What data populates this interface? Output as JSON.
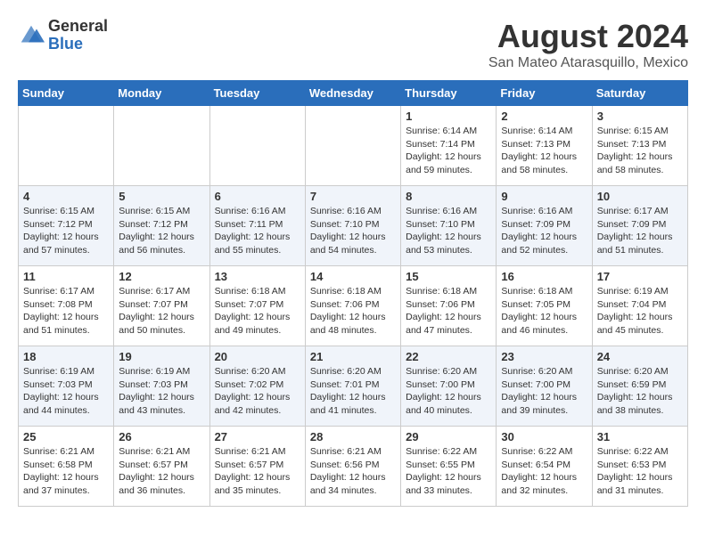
{
  "header": {
    "logo_general": "General",
    "logo_blue": "Blue",
    "month_title": "August 2024",
    "location": "San Mateo Atarasquillo, Mexico"
  },
  "weekdays": [
    "Sunday",
    "Monday",
    "Tuesday",
    "Wednesday",
    "Thursday",
    "Friday",
    "Saturday"
  ],
  "weeks": [
    [
      {
        "day": "",
        "info": ""
      },
      {
        "day": "",
        "info": ""
      },
      {
        "day": "",
        "info": ""
      },
      {
        "day": "",
        "info": ""
      },
      {
        "day": "1",
        "info": "Sunrise: 6:14 AM\nSunset: 7:14 PM\nDaylight: 12 hours\nand 59 minutes."
      },
      {
        "day": "2",
        "info": "Sunrise: 6:14 AM\nSunset: 7:13 PM\nDaylight: 12 hours\nand 58 minutes."
      },
      {
        "day": "3",
        "info": "Sunrise: 6:15 AM\nSunset: 7:13 PM\nDaylight: 12 hours\nand 58 minutes."
      }
    ],
    [
      {
        "day": "4",
        "info": "Sunrise: 6:15 AM\nSunset: 7:12 PM\nDaylight: 12 hours\nand 57 minutes."
      },
      {
        "day": "5",
        "info": "Sunrise: 6:15 AM\nSunset: 7:12 PM\nDaylight: 12 hours\nand 56 minutes."
      },
      {
        "day": "6",
        "info": "Sunrise: 6:16 AM\nSunset: 7:11 PM\nDaylight: 12 hours\nand 55 minutes."
      },
      {
        "day": "7",
        "info": "Sunrise: 6:16 AM\nSunset: 7:10 PM\nDaylight: 12 hours\nand 54 minutes."
      },
      {
        "day": "8",
        "info": "Sunrise: 6:16 AM\nSunset: 7:10 PM\nDaylight: 12 hours\nand 53 minutes."
      },
      {
        "day": "9",
        "info": "Sunrise: 6:16 AM\nSunset: 7:09 PM\nDaylight: 12 hours\nand 52 minutes."
      },
      {
        "day": "10",
        "info": "Sunrise: 6:17 AM\nSunset: 7:09 PM\nDaylight: 12 hours\nand 51 minutes."
      }
    ],
    [
      {
        "day": "11",
        "info": "Sunrise: 6:17 AM\nSunset: 7:08 PM\nDaylight: 12 hours\nand 51 minutes."
      },
      {
        "day": "12",
        "info": "Sunrise: 6:17 AM\nSunset: 7:07 PM\nDaylight: 12 hours\nand 50 minutes."
      },
      {
        "day": "13",
        "info": "Sunrise: 6:18 AM\nSunset: 7:07 PM\nDaylight: 12 hours\nand 49 minutes."
      },
      {
        "day": "14",
        "info": "Sunrise: 6:18 AM\nSunset: 7:06 PM\nDaylight: 12 hours\nand 48 minutes."
      },
      {
        "day": "15",
        "info": "Sunrise: 6:18 AM\nSunset: 7:06 PM\nDaylight: 12 hours\nand 47 minutes."
      },
      {
        "day": "16",
        "info": "Sunrise: 6:18 AM\nSunset: 7:05 PM\nDaylight: 12 hours\nand 46 minutes."
      },
      {
        "day": "17",
        "info": "Sunrise: 6:19 AM\nSunset: 7:04 PM\nDaylight: 12 hours\nand 45 minutes."
      }
    ],
    [
      {
        "day": "18",
        "info": "Sunrise: 6:19 AM\nSunset: 7:03 PM\nDaylight: 12 hours\nand 44 minutes."
      },
      {
        "day": "19",
        "info": "Sunrise: 6:19 AM\nSunset: 7:03 PM\nDaylight: 12 hours\nand 43 minutes."
      },
      {
        "day": "20",
        "info": "Sunrise: 6:20 AM\nSunset: 7:02 PM\nDaylight: 12 hours\nand 42 minutes."
      },
      {
        "day": "21",
        "info": "Sunrise: 6:20 AM\nSunset: 7:01 PM\nDaylight: 12 hours\nand 41 minutes."
      },
      {
        "day": "22",
        "info": "Sunrise: 6:20 AM\nSunset: 7:00 PM\nDaylight: 12 hours\nand 40 minutes."
      },
      {
        "day": "23",
        "info": "Sunrise: 6:20 AM\nSunset: 7:00 PM\nDaylight: 12 hours\nand 39 minutes."
      },
      {
        "day": "24",
        "info": "Sunrise: 6:20 AM\nSunset: 6:59 PM\nDaylight: 12 hours\nand 38 minutes."
      }
    ],
    [
      {
        "day": "25",
        "info": "Sunrise: 6:21 AM\nSunset: 6:58 PM\nDaylight: 12 hours\nand 37 minutes."
      },
      {
        "day": "26",
        "info": "Sunrise: 6:21 AM\nSunset: 6:57 PM\nDaylight: 12 hours\nand 36 minutes."
      },
      {
        "day": "27",
        "info": "Sunrise: 6:21 AM\nSunset: 6:57 PM\nDaylight: 12 hours\nand 35 minutes."
      },
      {
        "day": "28",
        "info": "Sunrise: 6:21 AM\nSunset: 6:56 PM\nDaylight: 12 hours\nand 34 minutes."
      },
      {
        "day": "29",
        "info": "Sunrise: 6:22 AM\nSunset: 6:55 PM\nDaylight: 12 hours\nand 33 minutes."
      },
      {
        "day": "30",
        "info": "Sunrise: 6:22 AM\nSunset: 6:54 PM\nDaylight: 12 hours\nand 32 minutes."
      },
      {
        "day": "31",
        "info": "Sunrise: 6:22 AM\nSunset: 6:53 PM\nDaylight: 12 hours\nand 31 minutes."
      }
    ]
  ]
}
